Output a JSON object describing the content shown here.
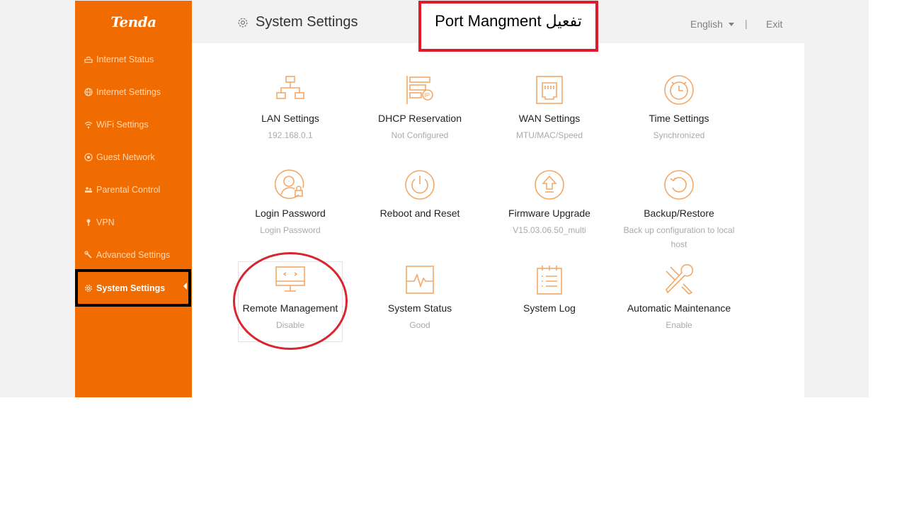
{
  "brand": {
    "logo_text": "Tenda",
    "accent": "#f06c00"
  },
  "sidebar": {
    "items": [
      {
        "label": "Internet Status",
        "icon": "router-icon"
      },
      {
        "label": "Internet Settings",
        "icon": "globe-icon"
      },
      {
        "label": "WiFi Settings",
        "icon": "wifi-icon"
      },
      {
        "label": "Guest Network",
        "icon": "guest-icon"
      },
      {
        "label": "Parental Control",
        "icon": "parental-icon"
      },
      {
        "label": "VPN",
        "icon": "vpn-icon"
      },
      {
        "label": "Advanced Settings",
        "icon": "wrench-icon"
      },
      {
        "label": "System Settings",
        "icon": "gear-icon",
        "active": true
      }
    ]
  },
  "header": {
    "title": "System Settings",
    "language": "English",
    "separator": "|",
    "exit_label": "Exit"
  },
  "annotation": {
    "text": "Port Mangment تفعيل",
    "color": "#e0192b"
  },
  "tiles": [
    {
      "name": "LAN Settings",
      "sub": "192.168.0.1",
      "icon": "network-icon"
    },
    {
      "name": "DHCP Reservation",
      "sub": "Not Configured",
      "icon": "dhcp-ip-icon"
    },
    {
      "name": "WAN Settings",
      "sub": "MTU/MAC/Speed",
      "icon": "ethernet-port-icon"
    },
    {
      "name": "Time Settings",
      "sub": "Synchronized",
      "icon": "alarm-clock-icon"
    },
    {
      "name": "Login Password",
      "sub": "Login Password",
      "icon": "user-lock-icon"
    },
    {
      "name": "Reboot and Reset",
      "sub": "",
      "icon": "power-icon"
    },
    {
      "name": "Firmware Upgrade",
      "sub": "V15.03.06.50_multi",
      "icon": "upgrade-icon"
    },
    {
      "name": "Backup/Restore",
      "sub": "Back up configuration to local host",
      "icon": "restore-icon"
    },
    {
      "name": "Remote Management",
      "sub": "Disable",
      "icon": "monitor-code-icon"
    },
    {
      "name": "System Status",
      "sub": "Good",
      "icon": "pulse-monitor-icon"
    },
    {
      "name": "System Log",
      "sub": "",
      "icon": "log-list-icon"
    },
    {
      "name": "Automatic Maintenance",
      "sub": "Enable",
      "icon": "tools-icon"
    }
  ]
}
